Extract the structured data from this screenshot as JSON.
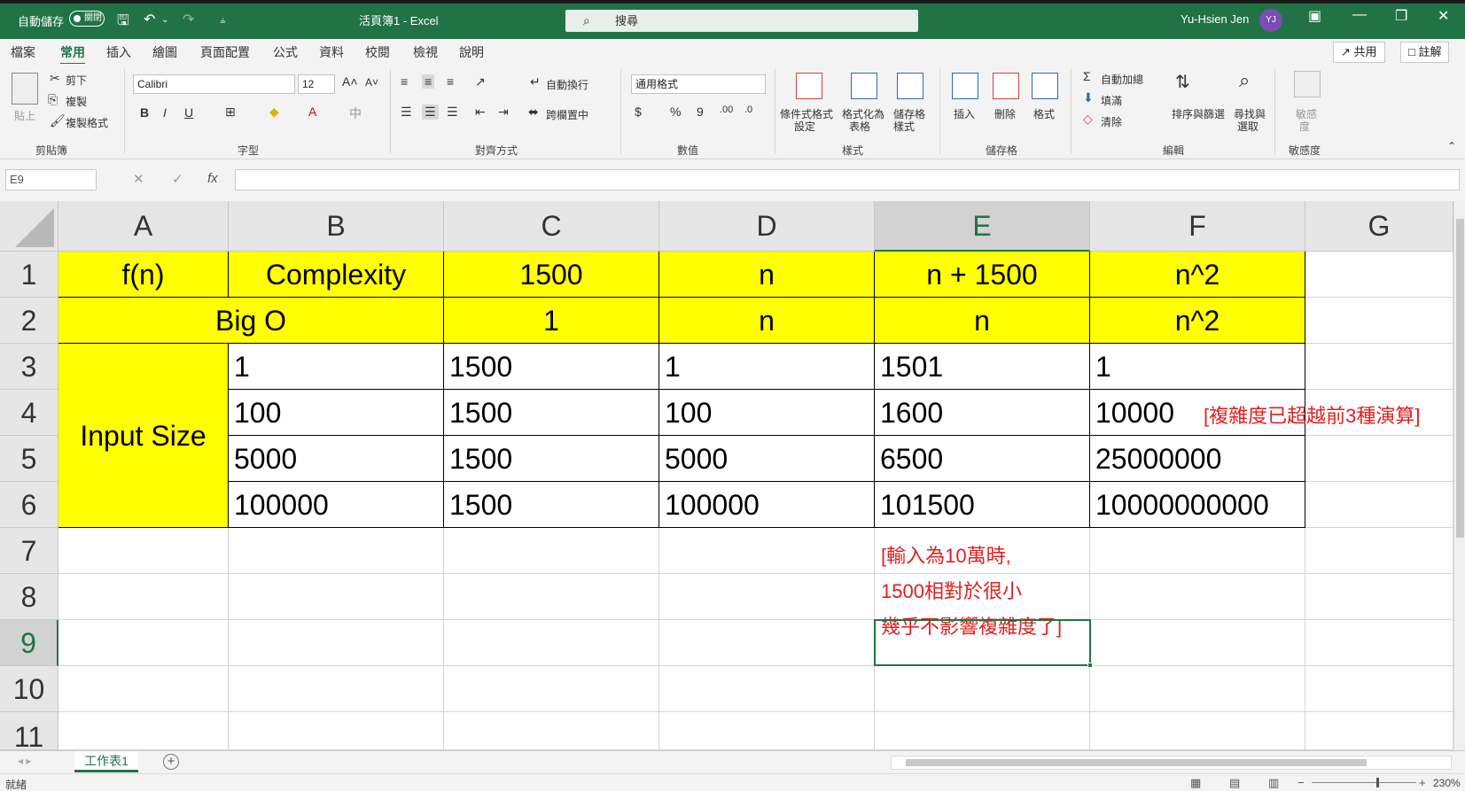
{
  "titlebar": {
    "autosave": "自動儲存",
    "autosave_state": "關閉",
    "doc_title": "活頁簿1  -  Excel",
    "search_placeholder": "搜尋",
    "user_name": "Yu-Hsien Jen",
    "user_initials": "YJ"
  },
  "menu": {
    "items": [
      "檔案",
      "常用",
      "插入",
      "繪圖",
      "頁面配置",
      "公式",
      "資料",
      "校閱",
      "檢視",
      "說明"
    ],
    "active": "常用",
    "share": "共用",
    "comment": "註解"
  },
  "ribbon": {
    "clipboard": {
      "label": "剪貼簿",
      "paste": "貼上",
      "cut": "剪下",
      "copy": "複製",
      "format_painter": "複製格式"
    },
    "font": {
      "label": "字型",
      "font_name": "Calibri",
      "font_size": "12"
    },
    "alignment": {
      "label": "對齊方式",
      "wrap": "自動換行",
      "merge": "跨欄置中"
    },
    "number": {
      "label": "數值",
      "format": "通用格式"
    },
    "styles": {
      "label": "樣式",
      "conditional": "條件式格式",
      "conditional2": "設定",
      "table": "格式化為",
      "table2": "表格",
      "cell_styles": "儲存格",
      "cell_styles2": "樣式"
    },
    "cells": {
      "label": "儲存格",
      "insert": "插入",
      "delete": "刪除",
      "format": "格式"
    },
    "editing": {
      "label": "編輯",
      "autosum": "自動加總",
      "fill": "填滿",
      "clear": "清除",
      "sort": "排序與篩選",
      "find": "尋找與",
      "find2": "選取"
    },
    "sensitivity": {
      "label": "敏感度",
      "btn": "敏感",
      "btn2": "度"
    }
  },
  "formula_bar": {
    "name_box": "E9",
    "fx": "fx",
    "content": ""
  },
  "columns": [
    "A",
    "B",
    "C",
    "D",
    "E",
    "F",
    "G"
  ],
  "rows": [
    "1",
    "2",
    "3",
    "4",
    "5",
    "6",
    "7",
    "8",
    "9",
    "10",
    "11"
  ],
  "cells": {
    "A1": "f(n)",
    "B1": "Complexity",
    "C1": "1500",
    "D1": "n",
    "E1": "n + 1500",
    "F1": "n^2",
    "A2B2": "Big O",
    "C2": "1",
    "D2": "n",
    "E2": "n",
    "F2": "n^2",
    "A3A6": "Input Size",
    "B3": "1",
    "C3": "1500",
    "D3": "1",
    "E3": "1501",
    "F3": "1",
    "B4": "100",
    "C4": "1500",
    "D4": "100",
    "E4": "1600",
    "F4": "10000",
    "B5": "5000",
    "C5": "1500",
    "D5": "5000",
    "E5": "6500",
    "F5": "25000000",
    "B6": "100000",
    "C6": "1500",
    "D6": "100000",
    "E6": "101500",
    "F6": "10000000000"
  },
  "notes": {
    "complexity_note": "[複雜度已超越前3種演算]",
    "line1": "[輸入為10萬時,",
    "line2": " 1500相對於很小",
    "line3": " 幾乎不影響複雜度了]"
  },
  "sheet": {
    "tab_name": "工作表1"
  },
  "status": {
    "ready": "就緒",
    "zoom": "230%"
  },
  "colors": {
    "excel_green": "#217346",
    "highlight": "#ffff00",
    "note_red": "#e02020"
  }
}
